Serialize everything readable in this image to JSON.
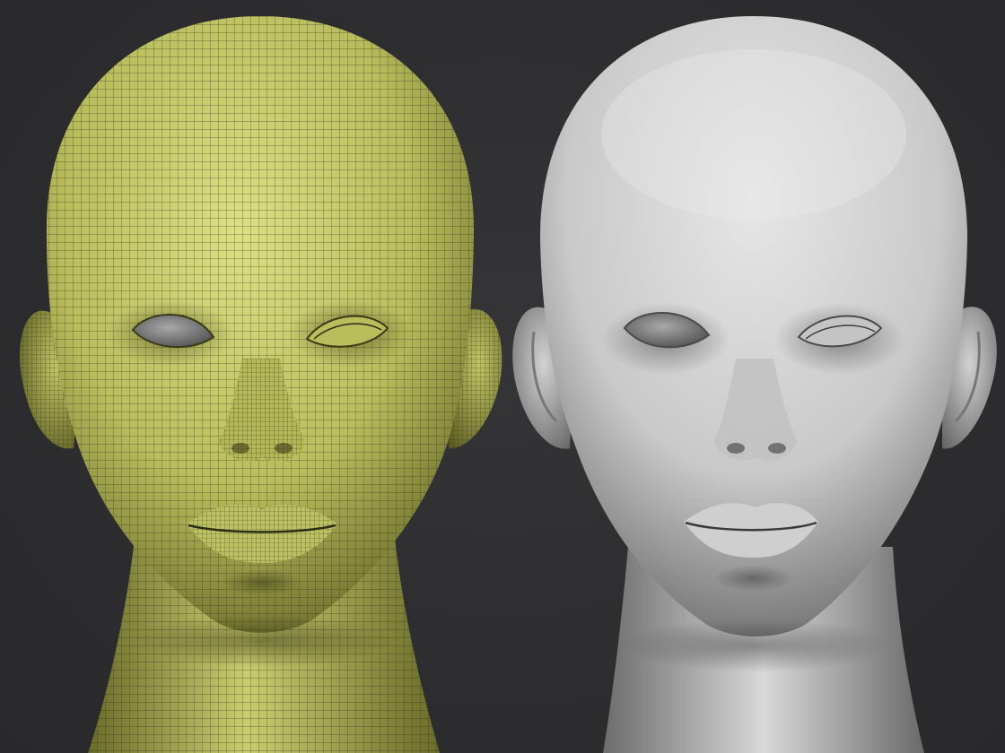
{
  "scene": {
    "description_free": true,
    "background_color": "#2f2f31",
    "left_model": {
      "render_style": "polypaint-wireframe",
      "base_color": "#c8cc6e",
      "wire_color": "#2b2d14",
      "eye_color": "#8c8c8c"
    },
    "right_model": {
      "render_style": "matcap-clay",
      "base_color": "#d8d8d8",
      "shadow_color": "#4a4a4a",
      "eye_color": "#9a9a9a"
    }
  }
}
